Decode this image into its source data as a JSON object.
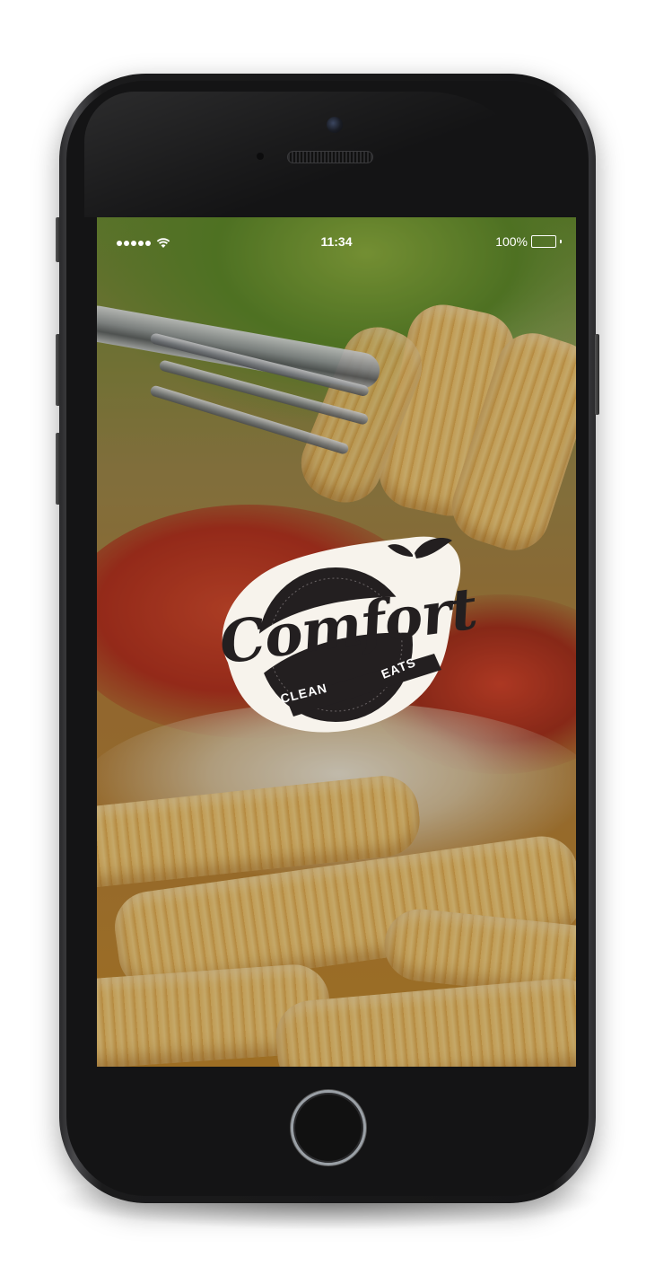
{
  "status_bar": {
    "time": "11:34",
    "battery_percent": "100%",
    "signal_bars": 5,
    "wifi": "wifi-icon",
    "battery_icon": "battery-full-icon"
  },
  "logo": {
    "word": "Comfort",
    "sub_left": "CLEAN",
    "sub_right": "EATS",
    "leaf_icon": "leaf-icon"
  },
  "device": {
    "home_button": "home-button"
  },
  "colors": {
    "logo_dark": "#231f20",
    "logo_light": "#ffffff",
    "screen_tint": "#c48a2c"
  }
}
